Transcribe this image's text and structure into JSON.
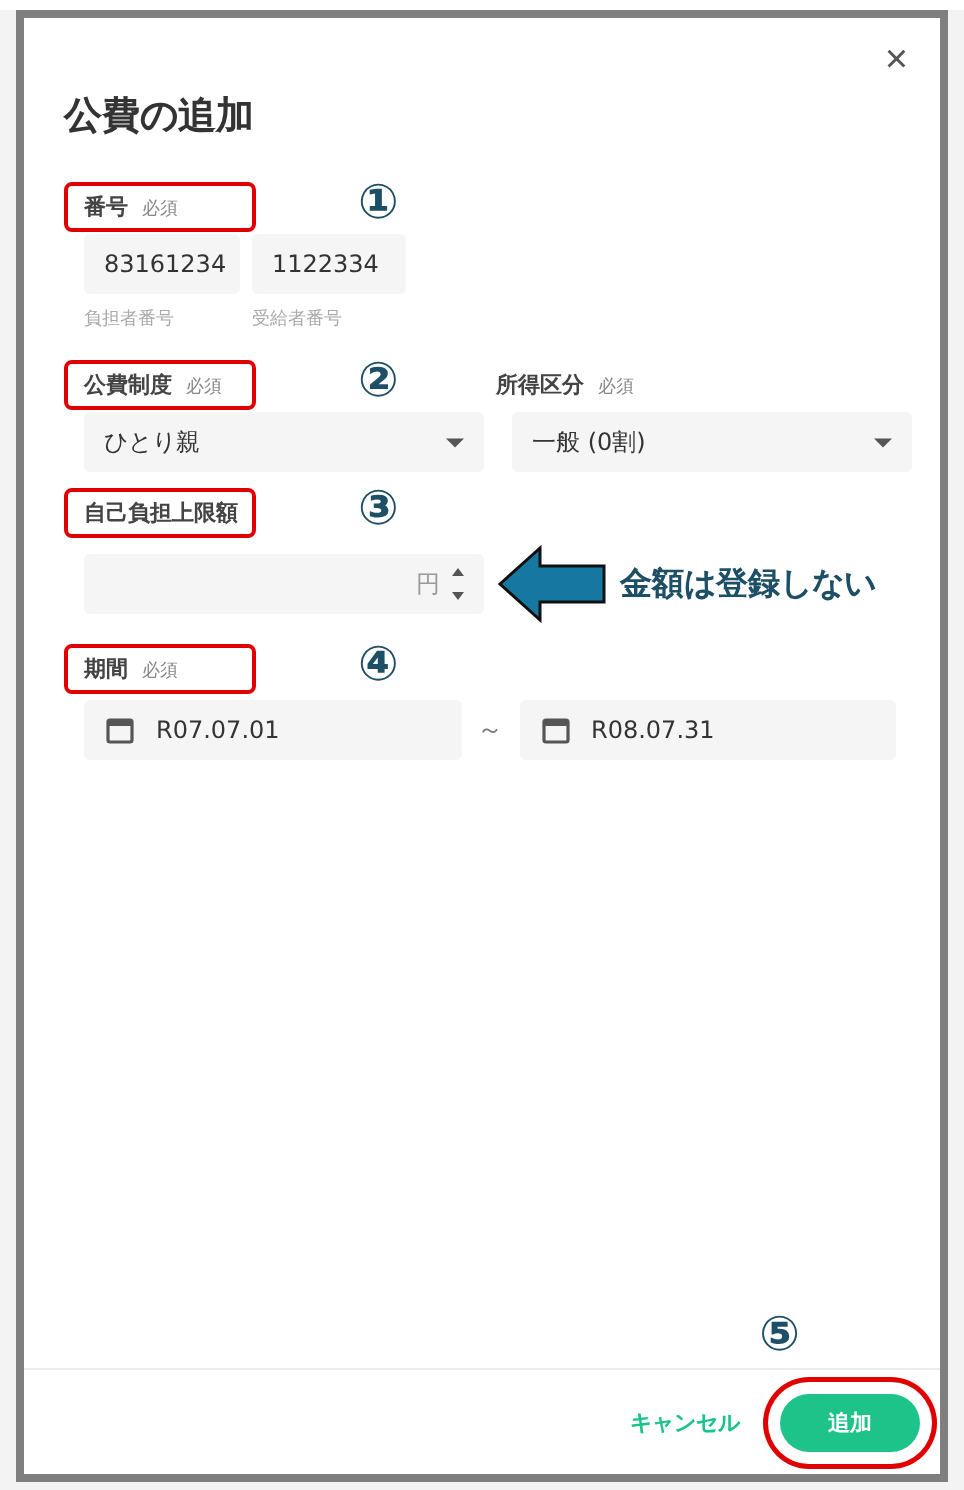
{
  "dialog": {
    "title": "公費の追加",
    "close": "×"
  },
  "number": {
    "label": "番号",
    "required": "必須",
    "highlighted": true,
    "marker": "①",
    "fields": [
      {
        "value": "83161234",
        "caption": "負担者番号"
      },
      {
        "value": "1122334",
        "caption": "受給者番号"
      }
    ]
  },
  "system": {
    "label": "公費制度",
    "required": "必須",
    "highlighted": true,
    "marker": "②",
    "value": "ひとり親"
  },
  "income": {
    "label": "所得区分",
    "required": "必須",
    "value": "一般 (0割)"
  },
  "limit": {
    "label": "自己負担上限額",
    "highlighted": true,
    "marker": "③",
    "unit": "円",
    "callout": "金額は登録しない"
  },
  "period": {
    "label": "期間",
    "required": "必須",
    "highlighted": true,
    "marker": "④",
    "from": "R07.07.01",
    "separator": "～",
    "to": "R08.07.31"
  },
  "footer": {
    "marker": "⑤",
    "cancel": "キャンセル",
    "submit": "追加",
    "submit_highlighted": true
  }
}
